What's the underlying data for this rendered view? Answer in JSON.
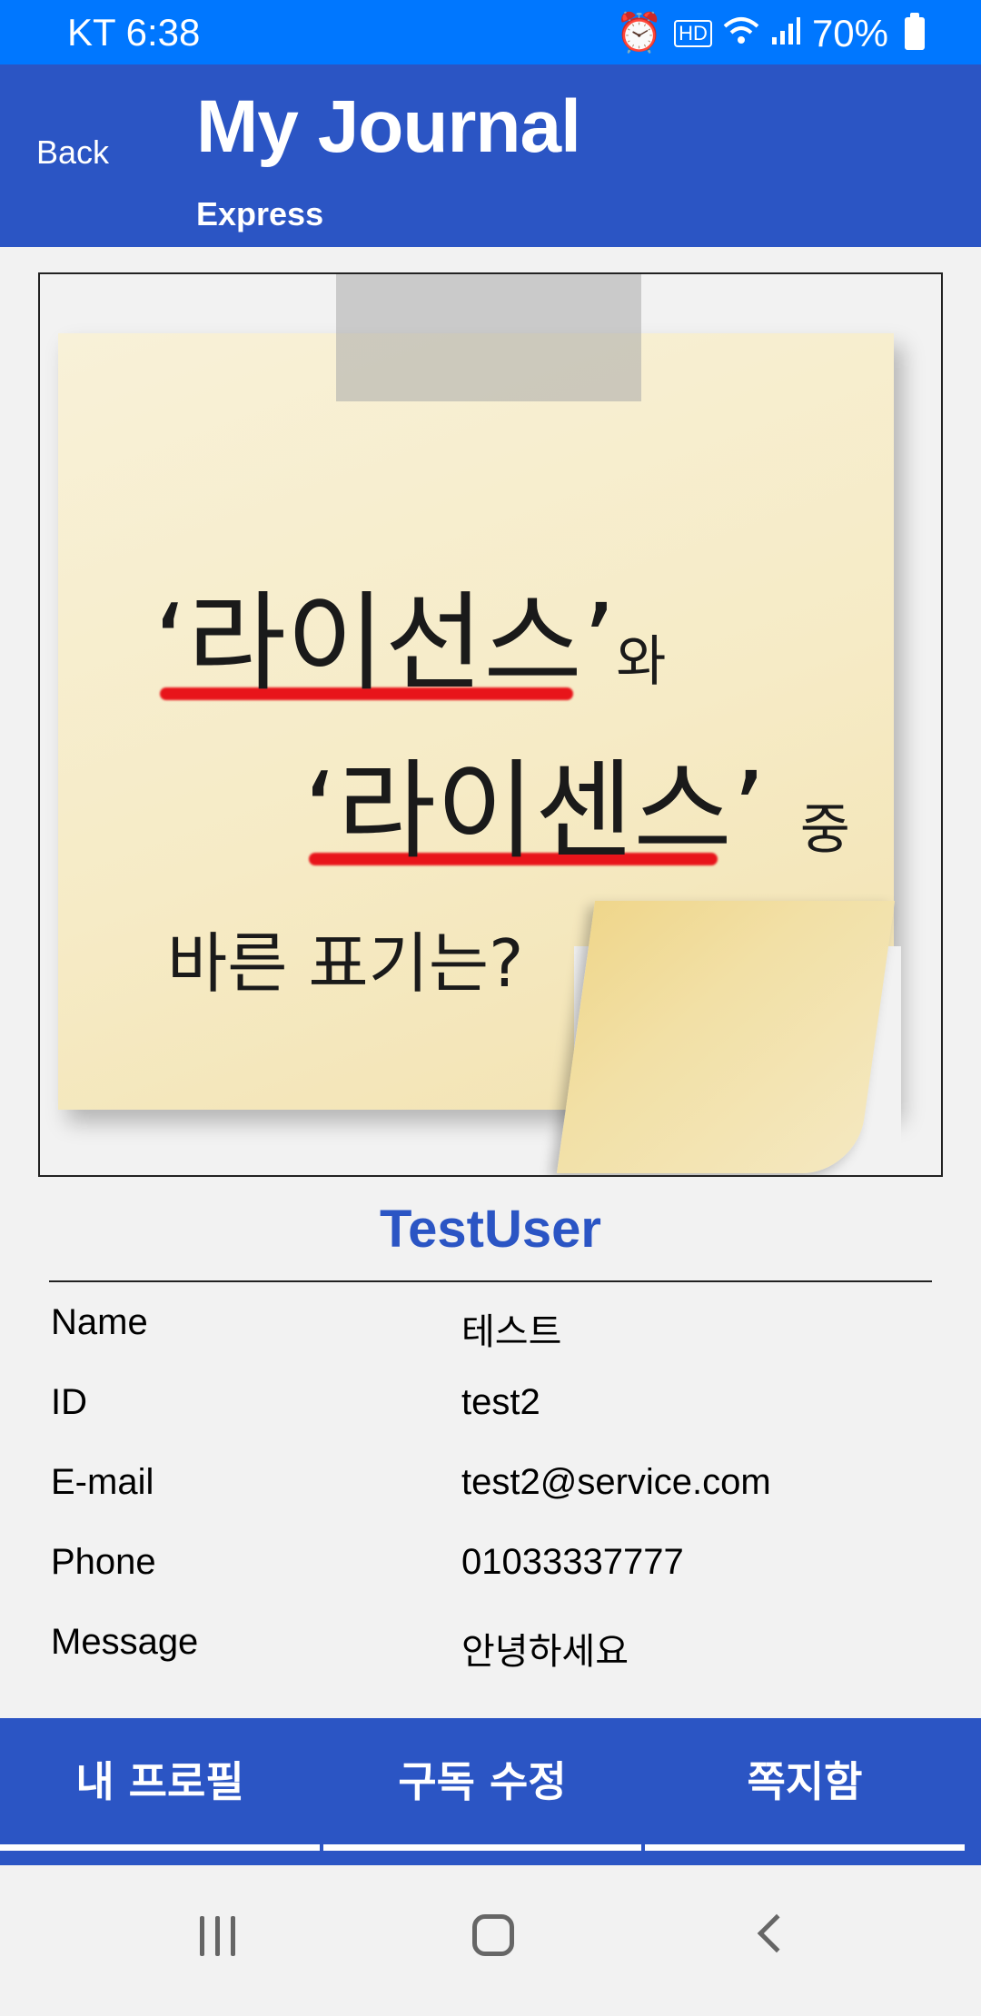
{
  "status_bar": {
    "carrier_time": "KT 6:38",
    "battery_percent": "70%",
    "icons": [
      "alarm-icon",
      "hd-icon",
      "wifi-icon",
      "signal-icon",
      "battery-icon"
    ]
  },
  "header": {
    "back_label": "Back",
    "title": "My Journal",
    "subtitle": "Express"
  },
  "image": {
    "line1_main": "‘라이선스’",
    "line1_suffix": "와",
    "line2_main": "‘라이센스’",
    "line2_suffix": "중",
    "line3": "바른 표기는?"
  },
  "profile": {
    "username": "TestUser",
    "rows": [
      {
        "label": "Name",
        "value": "테스트"
      },
      {
        "label": "ID",
        "value": "test2"
      },
      {
        "label": "E-mail",
        "value": "test2@service.com"
      },
      {
        "label": "Phone",
        "value": "01033337777"
      },
      {
        "label": "Message",
        "value": "안녕하세요"
      }
    ]
  },
  "tabs": [
    {
      "label": "내 프로필"
    },
    {
      "label": "구독 수정"
    },
    {
      "label": "쪽지함"
    }
  ],
  "colors": {
    "status_bar": "#0077ff",
    "primary": "#2b55c4",
    "background": "#f2f2f2"
  }
}
